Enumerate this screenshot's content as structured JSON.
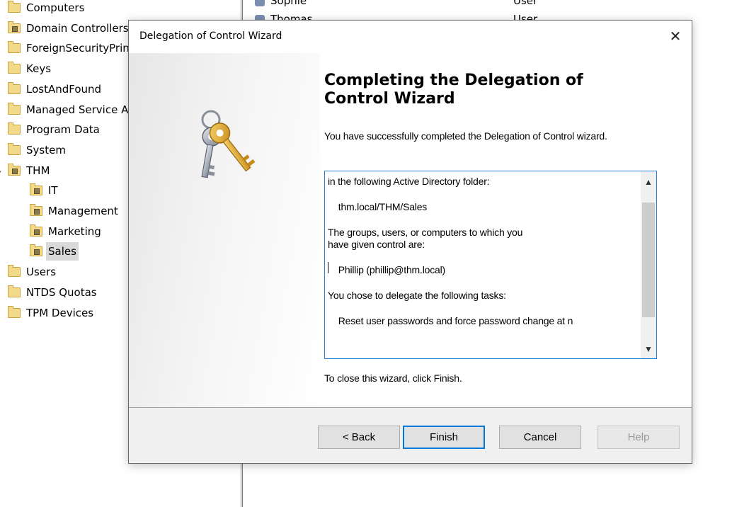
{
  "tree": {
    "items": [
      {
        "label": "Computers",
        "indent": 0,
        "ou": false
      },
      {
        "label": "Domain Controllers",
        "indent": 0,
        "ou": true
      },
      {
        "label": "ForeignSecurityPrincipals",
        "indent": 0,
        "ou": false
      },
      {
        "label": "Keys",
        "indent": 0,
        "ou": false
      },
      {
        "label": "LostAndFound",
        "indent": 0,
        "ou": false
      },
      {
        "label": "Managed Service Accounts",
        "indent": 0,
        "ou": false
      },
      {
        "label": "Program Data",
        "indent": 0,
        "ou": false
      },
      {
        "label": "System",
        "indent": 0,
        "ou": false
      },
      {
        "label": "THM",
        "indent": 0,
        "ou": true
      },
      {
        "label": "IT",
        "indent": 1,
        "ou": true
      },
      {
        "label": "Management",
        "indent": 1,
        "ou": true
      },
      {
        "label": "Marketing",
        "indent": 1,
        "ou": true
      },
      {
        "label": "Sales",
        "indent": 1,
        "ou": true,
        "selected": true
      },
      {
        "label": "Users",
        "indent": 0,
        "ou": false
      },
      {
        "label": "NTDS Quotas",
        "indent": 0,
        "ou": false
      },
      {
        "label": "TPM Devices",
        "indent": 0,
        "ou": false
      }
    ]
  },
  "list": {
    "rows": [
      {
        "name": "Sophie",
        "type": "User"
      },
      {
        "name": "Thomas",
        "type": "User"
      }
    ]
  },
  "dialog": {
    "title": "Delegation of Control Wizard",
    "close_glyph": "✕",
    "heading": "Completing the Delegation of Control Wizard",
    "intro": "You have successfully completed the Delegation of Control wizard.",
    "summary": {
      "line1": "in the following Active Directory folder:",
      "line2": "    thm.local/THM/Sales",
      "line3": "The groups, users, or computers to which you",
      "line4": "have given control are:",
      "line5": "    Phillip (phillip@thm.local)",
      "line6": "You chose to delegate the following tasks:",
      "line7": "    Reset user passwords and force password change at n"
    },
    "closing": "To close this wizard, click Finish.",
    "buttons": {
      "back": "< Back",
      "finish": "Finish",
      "cancel": "Cancel",
      "help": "Help"
    }
  },
  "icons": {
    "scroll_up": "▲",
    "scroll_down": "▼",
    "expand": "▾"
  }
}
